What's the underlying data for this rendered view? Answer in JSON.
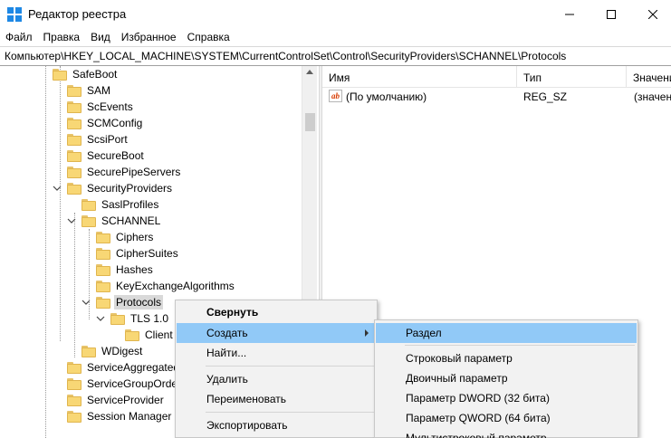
{
  "window": {
    "title": "Редактор реестра"
  },
  "menubar": {
    "items": [
      "Файл",
      "Правка",
      "Вид",
      "Избранное",
      "Справка"
    ]
  },
  "address": {
    "path": "Компьютер\\HKEY_LOCAL_MACHINE\\SYSTEM\\CurrentControlSet\\Control\\SecurityProviders\\SCHANNEL\\Protocols"
  },
  "tree": {
    "items": [
      {
        "label": "SafeBoot",
        "expander": "collapsed"
      },
      {
        "label": "SAM",
        "expander": "none"
      },
      {
        "label": "ScEvents",
        "expander": "none"
      },
      {
        "label": "SCMConfig",
        "expander": "none"
      },
      {
        "label": "ScsiPort",
        "expander": "none"
      },
      {
        "label": "SecureBoot",
        "expander": "collapsed"
      },
      {
        "label": "SecurePipeServers",
        "expander": "collapsed"
      },
      {
        "label": "SecurityProviders",
        "expander": "expanded"
      },
      {
        "label": "SaslProfiles",
        "expander": "none"
      },
      {
        "label": "SCHANNEL",
        "expander": "expanded"
      },
      {
        "label": "Ciphers",
        "expander": "none"
      },
      {
        "label": "CipherSuites",
        "expander": "none"
      },
      {
        "label": "Hashes",
        "expander": "none"
      },
      {
        "label": "KeyExchangeAlgorithms",
        "expander": "none"
      },
      {
        "label": "Protocols",
        "expander": "expanded",
        "selected": true
      },
      {
        "label": "TLS 1.0",
        "expander": "expanded"
      },
      {
        "label": "Client",
        "expander": "none"
      },
      {
        "label": "WDigest",
        "expander": "none"
      },
      {
        "label": "ServiceAggregatedEvents",
        "expander": "collapsed"
      },
      {
        "label": "ServiceGroupOrder",
        "expander": "collapsed"
      },
      {
        "label": "ServiceProvider",
        "expander": "collapsed"
      },
      {
        "label": "Session Manager",
        "expander": "collapsed"
      }
    ]
  },
  "list": {
    "columns": [
      "Имя",
      "Тип",
      "Значение"
    ],
    "rows": [
      {
        "name": "(По умолчанию)",
        "type": "REG_SZ",
        "value": "(значение не присвоено)"
      }
    ]
  },
  "context_menu": {
    "collapse": "Свернуть",
    "create": "Создать",
    "find": "Найти...",
    "delete": "Удалить",
    "rename": "Переименовать",
    "export": "Экспортировать"
  },
  "submenu": {
    "key": "Раздел",
    "string_value": "Строковый параметр",
    "binary_value": "Двоичный параметр",
    "dword_value": "Параметр DWORD (32 бита)",
    "qword_value": "Параметр QWORD (64 бита)",
    "multi_string_value": "Мультистроковый параметр"
  },
  "colors": {
    "menu_highlight": "#91c9f7",
    "folder": "#f8d775",
    "icon_blue": "#1e88e5"
  }
}
